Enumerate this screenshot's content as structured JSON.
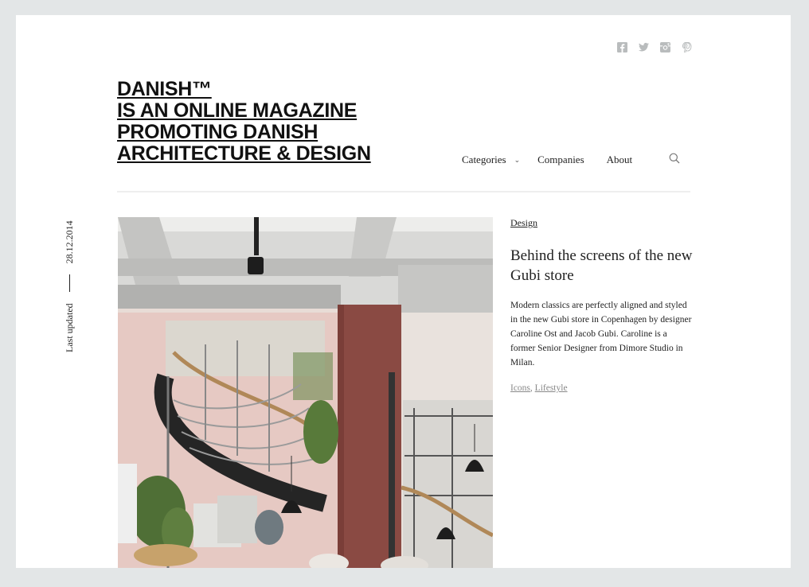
{
  "social": {
    "icons": [
      "facebook-icon",
      "twitter-icon",
      "instagram-icon",
      "pinterest-icon"
    ],
    "icon_color": "#b9bcbd"
  },
  "logo": {
    "lines": [
      "DANISH™",
      "IS AN ONLINE MAGAZINE",
      "PROMOTING DANISH",
      "ARCHITECTURE & DESIGN"
    ]
  },
  "nav": {
    "categories": "Categories",
    "companies": "Companies",
    "about": "About"
  },
  "meta": {
    "last_updated_label": "Last updated",
    "date": "28.12.2014"
  },
  "article": {
    "category": "Design",
    "title": "Behind the screens of the new Gubi store",
    "excerpt": "Modern classics are perfectly aligned and styled in the new Gubi store in Copenhagen by designer Caroline Ost and Jacob Gubi. Caroline is a former Senior Designer from Dimore Studio in Milan.",
    "tags": [
      "Icons",
      "Lifestyle"
    ],
    "tag_separator": ", "
  },
  "colors": {
    "background": "#e3e6e7",
    "page": "#ffffff",
    "text": "#222222",
    "pillar": "#8a4a43"
  }
}
